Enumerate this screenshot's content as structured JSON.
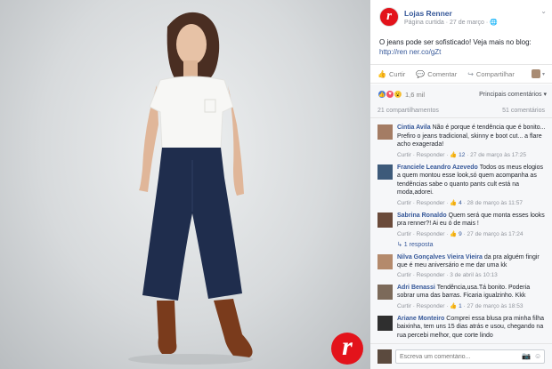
{
  "post": {
    "page_name": "Lojas Renner",
    "meta": "Página curtida · 27 de março · ",
    "text": "O jeans pode ser sofisticado! Veja mais no blog:",
    "link": "http://ren ner.co/gZt",
    "chevron": "⌄"
  },
  "actions": {
    "like": "Curtir",
    "comment": "Comentar",
    "share": "Compartilhar"
  },
  "reactions": {
    "count": "1,6 mil",
    "sort": "Principais comentários ▾",
    "shares": "21 compartilhamentos",
    "comments_count": "51 comentários"
  },
  "comments": [
    {
      "name": "Cintia Avila",
      "text": "Não é porque é tendência que é bonito... Prefiro o jeans tradicional, skinny e boot cut... a flare acho exagerada!",
      "links_pre": "Curtir · Responder · ",
      "likes": "12",
      "time": " · 27 de março às 17:25"
    },
    {
      "name": "Franciele Leandro Azevedo",
      "text": "Todos os meus elogios a quem montou esse look,só quem acompanha as tendências sabe o quanto pants cult está na moda,adorei.",
      "links_pre": "Curtir · Responder · ",
      "likes": "4",
      "time": " · 28 de março às 11:57"
    },
    {
      "name": "Sabrina Ronaldo",
      "text": "Quem será que monta esses looks pra renner?! Ai eu ó de mais !",
      "links_pre": "Curtir · Responder · ",
      "likes": "9",
      "time": " · 27 de março às 17:24"
    }
  ],
  "replies_link": "↳ 1 resposta",
  "comments2": [
    {
      "name": "Nilva Gonçalves Vieira Vieira",
      "text": "da pra alguém fingir que é meu aniversário e me dar uma kk",
      "links": "Curtir · Responder · 3 de abril às 10:13"
    },
    {
      "name": "Adri Benassi",
      "text": "Tendência,usa.Tá bonito. Poderia sobrar uma das barras. Ficaria igualzinho. Kkk",
      "links_pre": "Curtir · Responder · ",
      "likes": "1",
      "time": " · 27 de março às 18:53"
    },
    {
      "name": "Ariane Monteiro",
      "text": "Comprei essa blusa pra minha filha baixinha, tem uns 15 dias atrás e usou, chegando na rua percebi melhor, que corte lindo",
      "links": ""
    }
  ],
  "write": {
    "placeholder": "Escreva um comentário...",
    "camera_icon": "📷",
    "emoji_icon": "☺"
  },
  "colors": {
    "brand_red": "#e3131b",
    "link_blue": "#365899"
  }
}
